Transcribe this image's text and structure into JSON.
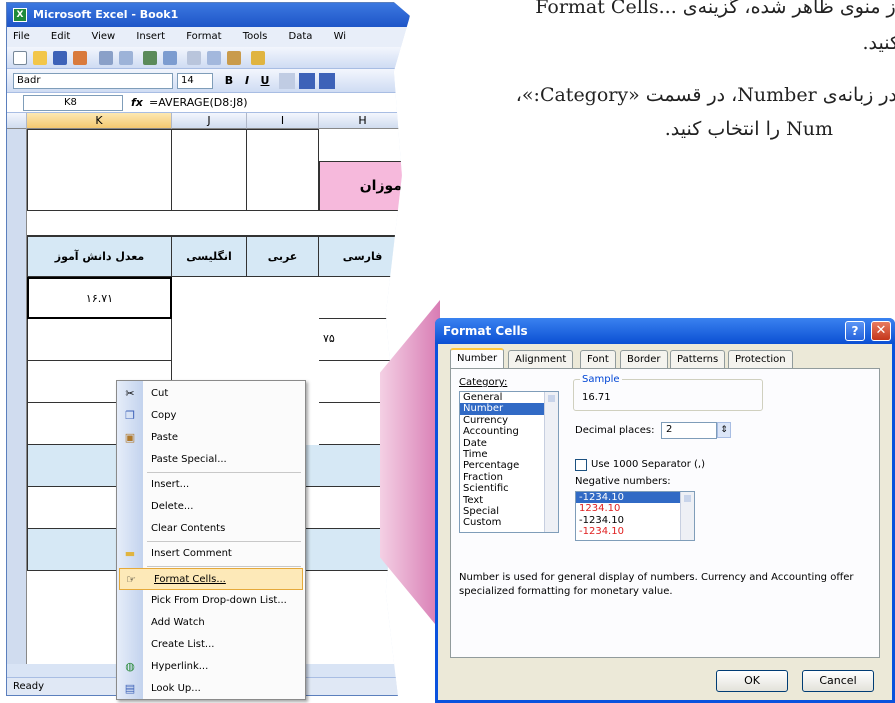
{
  "instructions": {
    "line1": "از منوی ظاهر شده، گزینه‌ی ...Format Cells",
    "line2": "کنید.",
    "line3": "در زبانه‌ی Number، در قسمت «Category:»،",
    "line4": "Num را انتخاب کنید."
  },
  "excel": {
    "title": "Microsoft Excel - Book1",
    "menu": [
      "File",
      "Edit",
      "View",
      "Insert",
      "Format",
      "Tools",
      "Data",
      "Wi"
    ],
    "font_name": "Badr",
    "font_size": "14",
    "name_box": "K8",
    "fx": "fx",
    "formula": "=AVERAGE(D8:J8)",
    "columns": [
      "K",
      "J",
      "I",
      "H"
    ],
    "banner_text": "موزان",
    "headers": [
      "معدل دانش آموز",
      "انگلیسی",
      "عربی",
      "فارسی"
    ],
    "row8_value": "۱۶.۷۱",
    "side_value": "۷۵",
    "status": "Ready"
  },
  "context_menu": {
    "items": [
      "Cut",
      "Copy",
      "Paste",
      "Paste Special...",
      "Insert...",
      "Delete...",
      "Clear Contents",
      "Insert Comment",
      "Format Cells...",
      "Pick From Drop-down List...",
      "Add Watch",
      "Create List...",
      "Hyperlink...",
      "Look Up..."
    ]
  },
  "dialog": {
    "title": "Format Cells",
    "help": "?",
    "close": "✕",
    "tabs": [
      "Number",
      "Alignment",
      "Font",
      "Border",
      "Patterns",
      "Protection"
    ],
    "category_label": "Category:",
    "categories": [
      "General",
      "Number",
      "Currency",
      "Accounting",
      "Date",
      "Time",
      "Percentage",
      "Fraction",
      "Scientific",
      "Text",
      "Special",
      "Custom"
    ],
    "selected_category": "Number",
    "sample_label": "Sample",
    "sample_value": "16.71",
    "decimal_label": "Decimal places:",
    "decimal_value": "2",
    "separator_label": "Use 1000 Separator (,)",
    "negative_label": "Negative numbers:",
    "negative_options": [
      "-1234.10",
      "1234.10",
      "-1234.10",
      "-1234.10"
    ],
    "description": "Number is used for general display of numbers.  Currency and Accounting offer specialized formatting for monetary value.",
    "ok": "OK",
    "cancel": "Cancel"
  },
  "colors": {
    "xp_blue": "#0a52dd",
    "selection": "#316ac5",
    "highlight": "#fde9b8",
    "pink": "#f6b9dc",
    "negative_red": "#e02020"
  }
}
